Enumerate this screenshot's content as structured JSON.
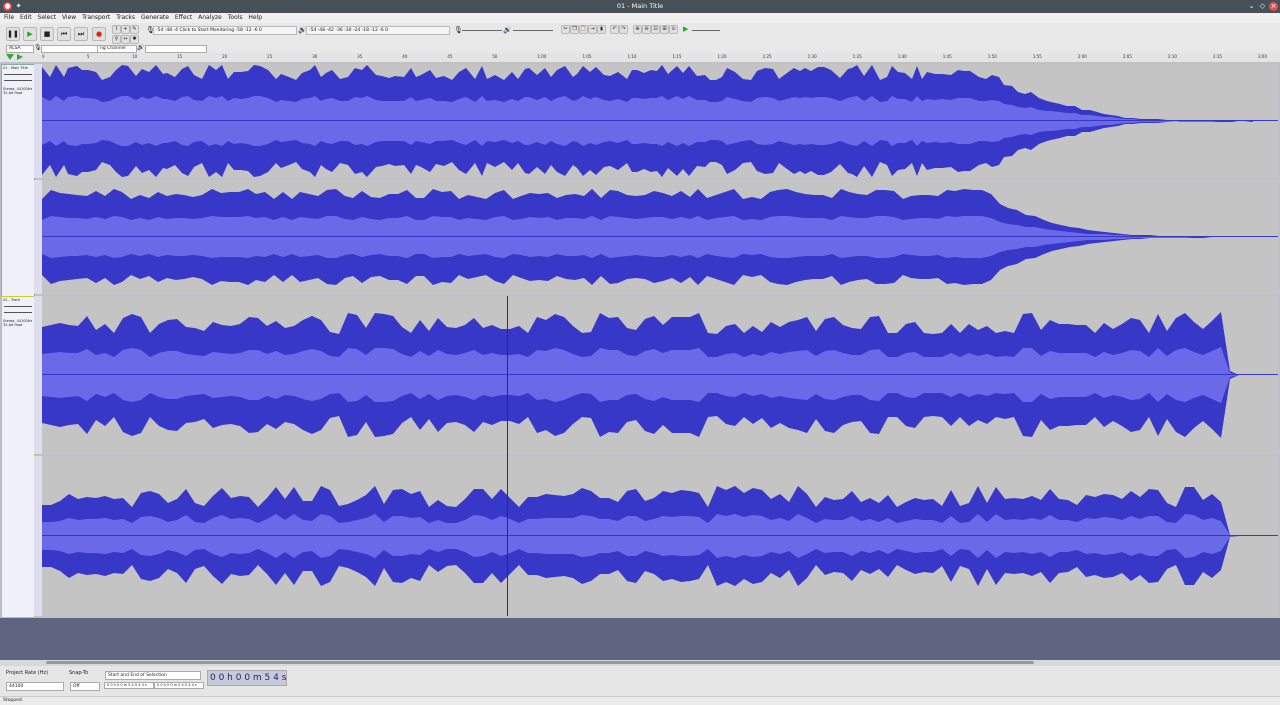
{
  "window": {
    "title": "01 - Main Title"
  },
  "menu": [
    "File",
    "Edit",
    "Select",
    "View",
    "Transport",
    "Tracks",
    "Generate",
    "Effect",
    "Analyze",
    "Tools",
    "Help"
  ],
  "toolbar": {
    "pause_icon": "❚❚",
    "play_icon": "▶",
    "stop_icon": "■",
    "skip_start_icon": "⏮",
    "skip_end_icon": "⏭",
    "record_icon": "●",
    "monitor_text": "Click to Start Monitoring",
    "rec_meter_ticks": "-54  -48  -4",
    "rec_meter_ticks2": "8  -12  -6  0",
    "play_meter_ticks": "-54  -48  -42  -36  -30  -24  -18  -12  -6  0"
  },
  "device": {
    "host": "ALSA",
    "channels": "ng Channel"
  },
  "ruler": {
    "ticks": [
      "0",
      "5",
      "10",
      "15",
      "20",
      "25",
      "30",
      "35",
      "40",
      "45",
      "50",
      "1:00",
      "1:05",
      "1:10",
      "1:15",
      "1:20",
      "1:25",
      "1:30",
      "1:35",
      "1:40",
      "1:45",
      "1:50",
      "1:55",
      "2:00",
      "2:05",
      "2:10",
      "2:15",
      "3:00"
    ]
  },
  "tracks": [
    {
      "name": "01 - Main Title",
      "info": "Stereo, 44100Hz\n32-bit float"
    },
    {
      "name": "02 - Track",
      "info": "Stereo, 44100Hz\n32-bit float"
    }
  ],
  "selection": {
    "project_rate_label": "Project Rate (Hz)",
    "project_rate": "44100",
    "snap_label": "Snap-To",
    "snap_value": "Off",
    "sel_mode": "Start and End of Selection",
    "start": "0 0 h 0 0 m 5 4.5 4 4 s",
    "end": "0 0 h 0 0 m 5 4.5 4 4 s",
    "time": "0 0 h 0 0 m 5 4 s"
  },
  "status": "Stopped."
}
